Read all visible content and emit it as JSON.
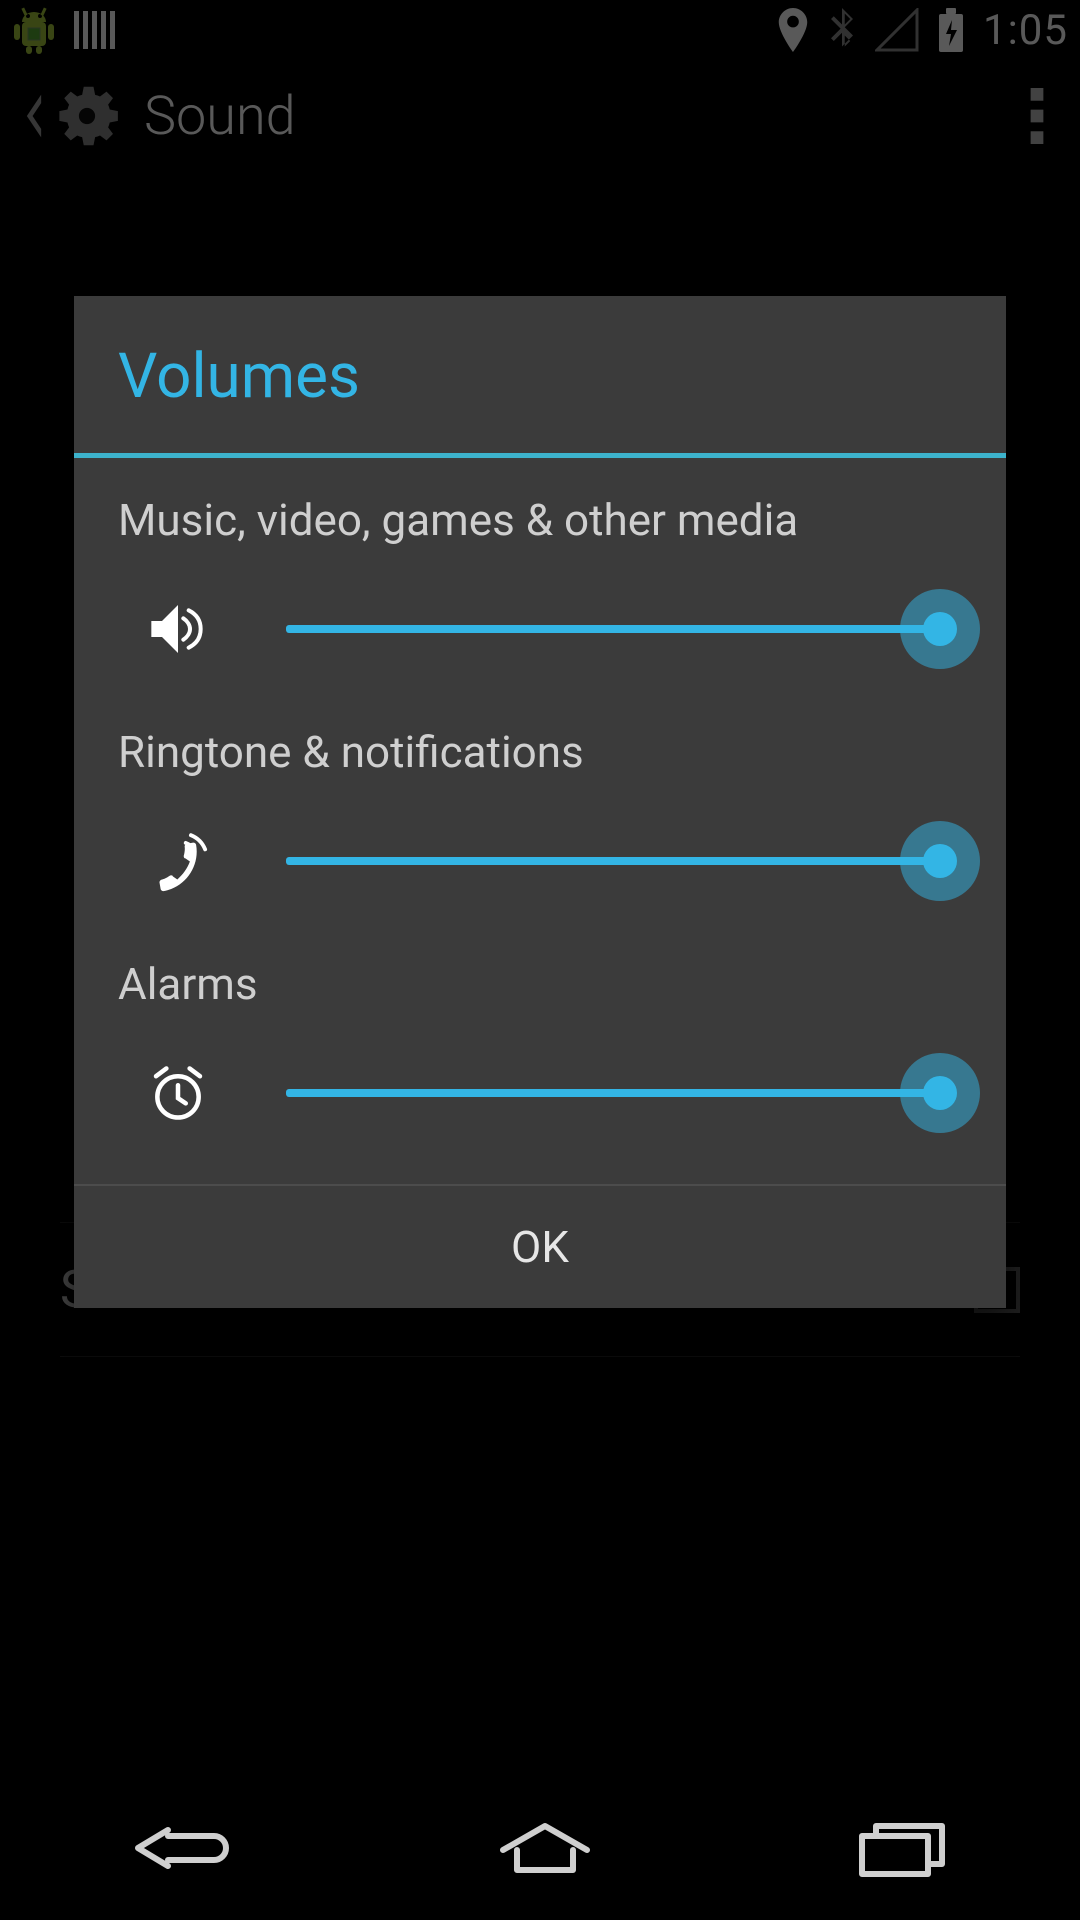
{
  "status_bar": {
    "time": "1:05"
  },
  "action_bar": {
    "title": "Sound"
  },
  "underlay": {
    "screen_lock_sounds": {
      "label": "Screen lock sounds",
      "checked": false
    }
  },
  "dialog": {
    "title": "Volumes",
    "sliders": {
      "media": {
        "label": "Music, video, games & other media",
        "icon": "speaker-icon",
        "value_percent": 100
      },
      "ringtone": {
        "label": "Ringtone & notifications",
        "icon": "phone-ring-icon",
        "value_percent": 100
      },
      "alarm": {
        "label": "Alarms",
        "icon": "alarm-clock-icon",
        "value_percent": 100
      }
    },
    "ok_label": "OK"
  },
  "colors": {
    "accent": "#33b5e5",
    "divider": "#3db3cc",
    "dialog_bg": "#3b3b3b"
  }
}
